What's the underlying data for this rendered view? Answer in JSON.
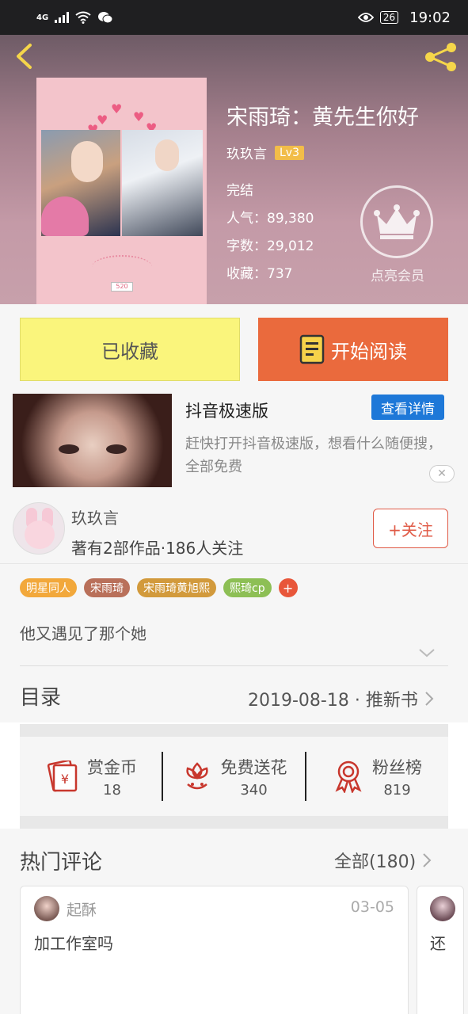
{
  "status_bar": {
    "network": "4G",
    "battery": "26",
    "time": "19:02"
  },
  "book": {
    "title": "宋雨琦：黄先生你好",
    "author": "玖玖言",
    "level": "Lv3",
    "status": "完结",
    "popularity_label": "人气：",
    "popularity": "89,380",
    "words_label": "字数：",
    "words": "29,012",
    "favorites_label": "收藏：",
    "favorites": "737",
    "cover_tag": "520"
  },
  "vip": {
    "label": "点亮会员"
  },
  "actions": {
    "collected_label": "已收藏",
    "read_label": "开始阅读"
  },
  "ad": {
    "title": "抖音极速版",
    "detail_label": "查看详情",
    "description": "赶快打开抖音极速版，想看什么随便搜，全部免费"
  },
  "author": {
    "name": "玖玖言",
    "meta": "著有2部作品·186人关注",
    "follow_label": "+关注"
  },
  "tags": [
    {
      "label": "明星同人",
      "color": "#f2a83b"
    },
    {
      "label": "宋雨琦",
      "color": "#b9705a"
    },
    {
      "label": "宋雨琦黄旭熙",
      "color": "#d29a3c"
    },
    {
      "label": "熙琦cp",
      "color": "#8dbf55"
    }
  ],
  "tag_more": "+",
  "summary": "他又遇见了那个她",
  "toc": {
    "label": "目录",
    "meta": "2019-08-18 · 推新书"
  },
  "stats": [
    {
      "name": "赏金币",
      "value": "18",
      "icon": "red-envelope-icon"
    },
    {
      "name": "免费送花",
      "value": "340",
      "icon": "flower-icon"
    },
    {
      "name": "粉丝榜",
      "value": "819",
      "icon": "medal-icon"
    }
  ],
  "comments": {
    "title": "热门评论",
    "all_label": "全部(180)",
    "items": [
      {
        "user": "起酥",
        "date": "03-05",
        "text": "加工作室吗"
      },
      {
        "text": "还"
      }
    ]
  },
  "colors": {
    "accent_orange": "#ea6a3d",
    "collected_yellow": "#faf57c",
    "ad_blue": "#1e78d8",
    "follow_red": "#e05a46",
    "level_gold": "#f2bd49"
  }
}
